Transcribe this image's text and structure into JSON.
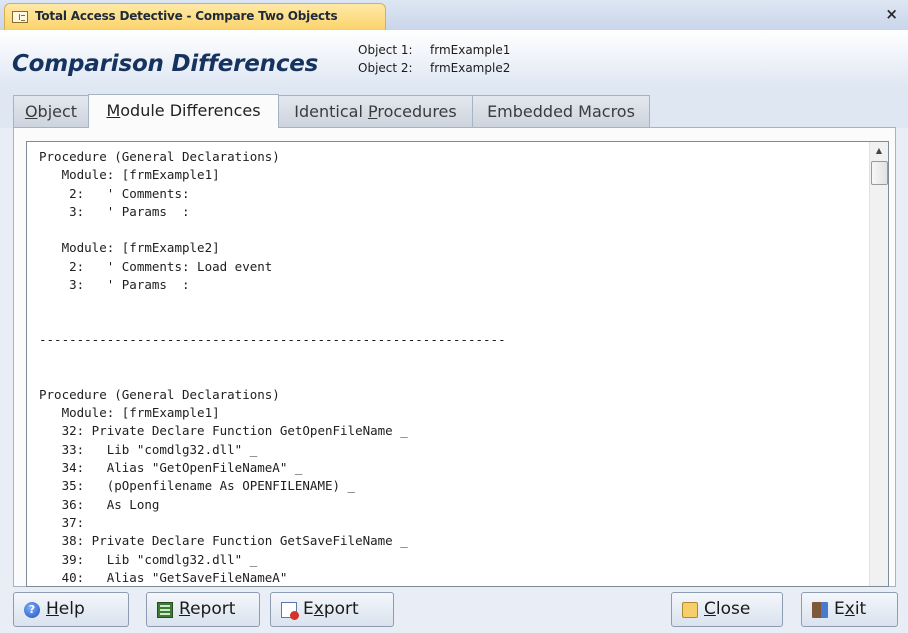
{
  "window": {
    "title": "Total Access Detective - Compare Two Objects",
    "close_glyph": "×"
  },
  "header": {
    "title": "Comparison Differences",
    "object1_label": "Object 1:",
    "object1_value": "frmExample1",
    "object2_label": "Object 2:",
    "object2_value": "frmExample2"
  },
  "tabs": [
    {
      "pre": "",
      "key": "O",
      "post": "bject",
      "active": false
    },
    {
      "pre": "",
      "key": "M",
      "post": "odule Differences",
      "active": true
    },
    {
      "pre": "Identical ",
      "key": "P",
      "post": "rocedures",
      "active": false
    },
    {
      "pre": "Embedded Macros",
      "key": "",
      "post": "",
      "active": false
    }
  ],
  "code_lines": [
    "Procedure (General Declarations)",
    "   Module: [frmExample1]",
    "    2:   ' Comments:",
    "    3:   ' Params  :",
    "",
    "   Module: [frmExample2]",
    "    2:   ' Comments: Load event",
    "    3:   ' Params  :",
    "",
    "",
    "--------------------------------------------------------------",
    "",
    "",
    "Procedure (General Declarations)",
    "   Module: [frmExample1]",
    "   32: Private Declare Function GetOpenFileName _",
    "   33:   Lib \"comdlg32.dll\" _",
    "   34:   Alias \"GetOpenFileNameA\" _",
    "   35:   (pOpenfilename As OPENFILENAME) _",
    "   36:   As Long",
    "   37:",
    "   38: Private Declare Function GetSaveFileName _",
    "   39:   Lib \"comdlg32.dll\" _",
    "   40:   Alias \"GetSaveFileNameA\""
  ],
  "scrollbar": {
    "up_glyph": "▲"
  },
  "buttons": {
    "help": {
      "pre": "",
      "key": "H",
      "post": "elp",
      "icon": "help-icon",
      "icon_glyph": "?"
    },
    "report": {
      "pre": "",
      "key": "R",
      "post": "eport",
      "icon": "report-icon"
    },
    "export": {
      "pre": "E",
      "key": "x",
      "post": "port",
      "icon": "export-icon"
    },
    "close": {
      "pre": "",
      "key": "C",
      "post": "lose",
      "icon": "close-folder-icon"
    },
    "exit": {
      "pre": "E",
      "key": "x",
      "post": "it",
      "icon": "exit-door-icon"
    }
  }
}
